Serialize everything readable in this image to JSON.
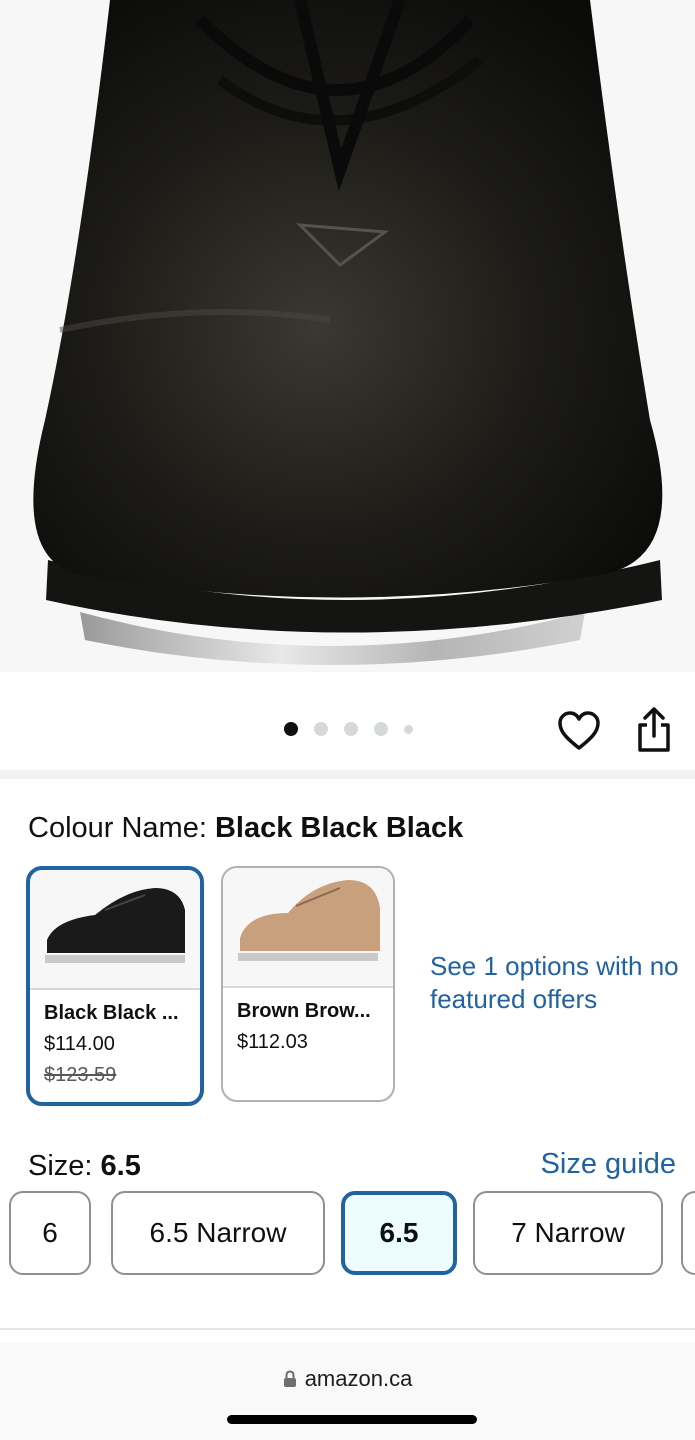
{
  "carousel": {
    "dot_count": 5,
    "active_index": 0
  },
  "icons": {
    "favorite": "heart-icon",
    "share": "share-icon",
    "lock": "lock-icon"
  },
  "colour": {
    "label": "Colour Name: ",
    "selected_value": "Black Black Black",
    "options": [
      {
        "name": "Black Black ...",
        "price": "$114.00",
        "list_price": "$123.59",
        "selected": true
      },
      {
        "name": "Brown Brow...",
        "price": "$112.03",
        "selected": false
      }
    ],
    "more_options_text": "See 1 options with no featured offers"
  },
  "size": {
    "label": "Size: ",
    "selected_value": "6.5",
    "guide_link": "Size guide",
    "options": [
      "6",
      "6.5 Narrow",
      "6.5",
      "7 Narrow"
    ]
  },
  "browser": {
    "url": "amazon.ca"
  },
  "colors": {
    "link": "#2162a1",
    "selected_bg": "#edfdff",
    "text": "#0f1111"
  }
}
